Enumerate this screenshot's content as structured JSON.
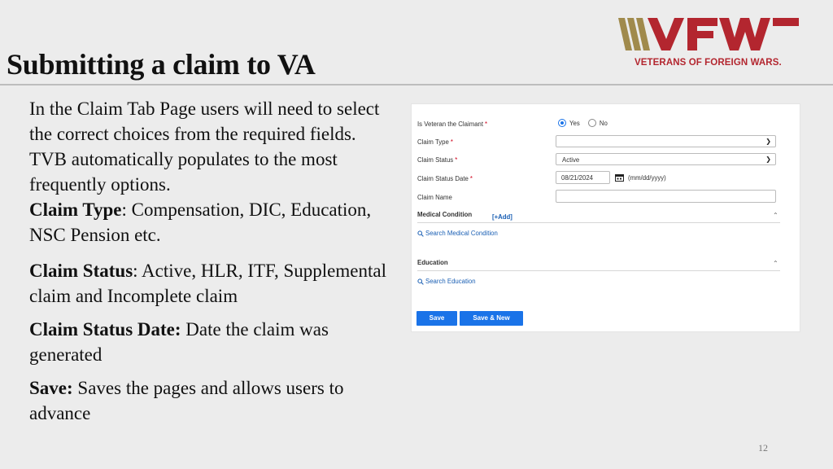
{
  "slide": {
    "title": "Submitting a claim to VA",
    "page_number": "12",
    "logo": {
      "wordmark": "VFW",
      "subtitle": "VETERANS OF FOREIGN WARS.",
      "color": "#b3262f",
      "stripe_color": "#a08a4c"
    },
    "body": {
      "intro": "In the Claim Tab Page users will need to select the correct choices from the required fields. TVB automatically populates to the most frequently options.",
      "items": [
        {
          "term": "Claim Type",
          "separator": ":",
          "text": " Compensation, DIC, Education, NSC Pension etc."
        },
        {
          "term": "Claim Status",
          "separator": ":",
          "text": " Active, HLR, ITF, Supplemental claim and Incomplete claim"
        },
        {
          "term": "Claim Status Date:",
          "separator": "",
          "text": " Date the claim was generated"
        },
        {
          "term": "Save:",
          "separator": "",
          "text": " Saves the pages and allows users to advance"
        }
      ]
    }
  },
  "form": {
    "accent_color": "#1a73e8",
    "veteran_claimant": {
      "label": "Is Veteran the Claimant",
      "required": "*",
      "options": [
        "Yes",
        "No"
      ],
      "selected": "Yes"
    },
    "claim_type": {
      "label": "Claim Type",
      "required": "*",
      "value": ""
    },
    "claim_status": {
      "label": "Claim Status",
      "required": "*",
      "value": "Active"
    },
    "claim_status_date": {
      "label": "Claim Status Date",
      "required": "*",
      "value": "08/21/2024",
      "hint": "(mm/dd/yyyy)"
    },
    "claim_name": {
      "label": "Claim Name",
      "value": ""
    },
    "medical_condition": {
      "title": "Medical Condition",
      "add_label": "[+Add]",
      "search_label": "Search Medical Condition"
    },
    "education": {
      "title": "Education",
      "search_label": "Search Education"
    },
    "buttons": {
      "save": "Save",
      "save_new": "Save & New"
    }
  }
}
